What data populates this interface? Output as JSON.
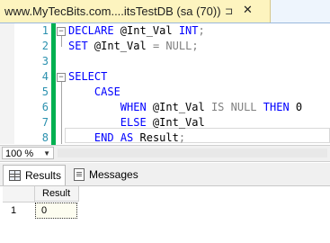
{
  "tab": {
    "title": "www.MyTecBits.com....itsTestDB (sa (70))",
    "pin": "⊐",
    "close": "✕"
  },
  "editor": {
    "lines": [
      {
        "num": "1",
        "tokens": [
          {
            "t": "DECLARE",
            "c": "kw"
          },
          {
            "t": " @Int_Val "
          },
          {
            "t": "INT",
            "c": "kw"
          },
          {
            "t": ";",
            "c": "op"
          }
        ]
      },
      {
        "num": "2",
        "tokens": [
          {
            "t": "SET",
            "c": "kw"
          },
          {
            "t": " @Int_Val "
          },
          {
            "t": "=",
            "c": "op"
          },
          {
            "t": " "
          },
          {
            "t": "NULL",
            "c": "op"
          },
          {
            "t": ";",
            "c": "op"
          }
        ]
      },
      {
        "num": "3",
        "tokens": []
      },
      {
        "num": "4",
        "tokens": [
          {
            "t": "SELECT",
            "c": "kw"
          }
        ]
      },
      {
        "num": "5",
        "tokens": [
          {
            "t": "    "
          },
          {
            "t": "CASE",
            "c": "kw"
          }
        ]
      },
      {
        "num": "6",
        "tokens": [
          {
            "t": "        "
          },
          {
            "t": "WHEN",
            "c": "kw"
          },
          {
            "t": " @Int_Val "
          },
          {
            "t": "IS NULL",
            "c": "op"
          },
          {
            "t": " "
          },
          {
            "t": "THEN",
            "c": "kw"
          },
          {
            "t": " 0"
          }
        ]
      },
      {
        "num": "7",
        "tokens": [
          {
            "t": "        "
          },
          {
            "t": "ELSE",
            "c": "kw"
          },
          {
            "t": " @Int_Val"
          }
        ]
      },
      {
        "num": "8",
        "tokens": [
          {
            "t": "    "
          },
          {
            "t": "END",
            "c": "kw"
          },
          {
            "t": " "
          },
          {
            "t": "AS",
            "c": "kw"
          },
          {
            "t": " Result"
          },
          {
            "t": ";",
            "c": "op"
          }
        ]
      }
    ]
  },
  "zoom": {
    "value": "100 %"
  },
  "results_tabs": {
    "results": "Results",
    "messages": "Messages"
  },
  "grid": {
    "column": "Result",
    "rows": [
      {
        "num": "1",
        "value": "0"
      }
    ]
  }
}
